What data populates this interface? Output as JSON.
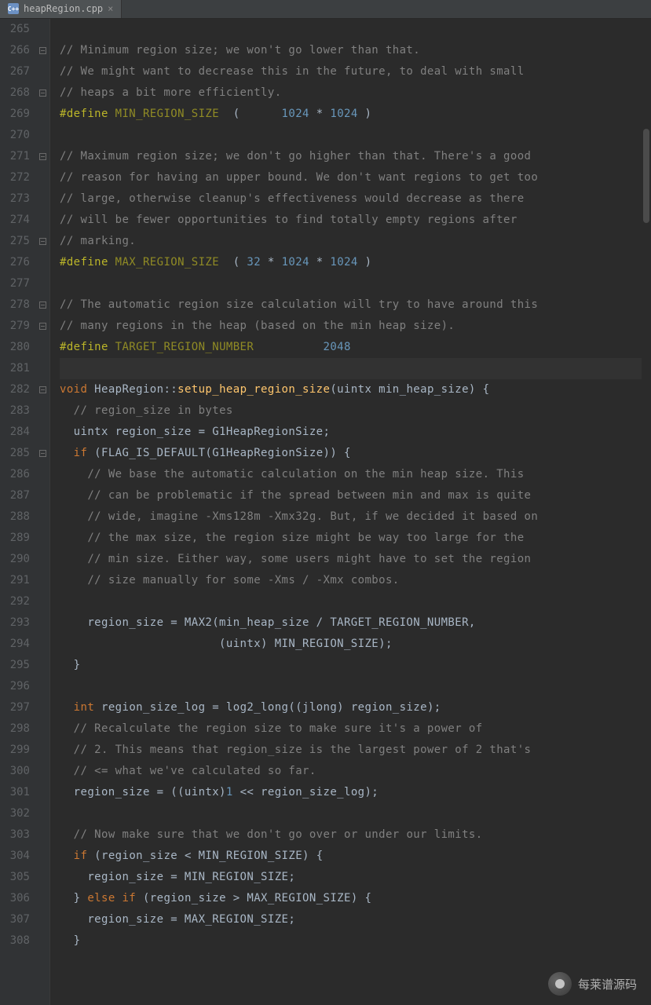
{
  "tab": {
    "icon_label": "C++",
    "filename": "heapRegion.cpp",
    "close_glyph": "×"
  },
  "line_start": 265,
  "highlight_line": 281,
  "fold_lines": [
    266,
    268,
    271,
    275,
    278,
    279,
    282,
    285
  ],
  "lines": [
    {
      "n": 265,
      "seg": [
        {
          "t": "",
          "cls": ""
        }
      ]
    },
    {
      "n": 266,
      "seg": [
        {
          "t": "// Minimum region size; we won't go lower than that.",
          "cls": "c-comment"
        }
      ]
    },
    {
      "n": 267,
      "seg": [
        {
          "t": "// We might want to decrease this in the future, to deal with small",
          "cls": "c-comment"
        }
      ]
    },
    {
      "n": 268,
      "seg": [
        {
          "t": "// heaps a bit more efficiently.",
          "cls": "c-comment"
        }
      ]
    },
    {
      "n": 269,
      "seg": [
        {
          "t": "#define ",
          "cls": "c-define"
        },
        {
          "t": "MIN_REGION_SIZE",
          "cls": "c-macro"
        },
        {
          "t": "  (      ",
          "cls": ""
        },
        {
          "t": "1024",
          "cls": "c-number"
        },
        {
          "t": " * ",
          "cls": ""
        },
        {
          "t": "1024",
          "cls": "c-number"
        },
        {
          "t": " )",
          "cls": ""
        }
      ]
    },
    {
      "n": 270,
      "seg": [
        {
          "t": "",
          "cls": ""
        }
      ]
    },
    {
      "n": 271,
      "seg": [
        {
          "t": "// Maximum region size; we don't go higher than that. There's a good",
          "cls": "c-comment"
        }
      ]
    },
    {
      "n": 272,
      "seg": [
        {
          "t": "// reason for having an upper bound. We don't want regions to get too",
          "cls": "c-comment"
        }
      ]
    },
    {
      "n": 273,
      "seg": [
        {
          "t": "// large, otherwise cleanup's effectiveness would decrease as there",
          "cls": "c-comment"
        }
      ]
    },
    {
      "n": 274,
      "seg": [
        {
          "t": "// will be fewer opportunities to find totally empty regions after",
          "cls": "c-comment"
        }
      ]
    },
    {
      "n": 275,
      "seg": [
        {
          "t": "// marking.",
          "cls": "c-comment"
        }
      ]
    },
    {
      "n": 276,
      "seg": [
        {
          "t": "#define ",
          "cls": "c-define"
        },
        {
          "t": "MAX_REGION_SIZE",
          "cls": "c-macro"
        },
        {
          "t": "  ( ",
          "cls": ""
        },
        {
          "t": "32",
          "cls": "c-number"
        },
        {
          "t": " * ",
          "cls": ""
        },
        {
          "t": "1024",
          "cls": "c-number"
        },
        {
          "t": " * ",
          "cls": ""
        },
        {
          "t": "1024",
          "cls": "c-number"
        },
        {
          "t": " )",
          "cls": ""
        }
      ]
    },
    {
      "n": 277,
      "seg": [
        {
          "t": "",
          "cls": ""
        }
      ]
    },
    {
      "n": 278,
      "seg": [
        {
          "t": "// The automatic region size calculation will try to have around this",
          "cls": "c-comment"
        }
      ]
    },
    {
      "n": 279,
      "seg": [
        {
          "t": "// many regions in the heap (based on the min heap size).",
          "cls": "c-comment"
        }
      ]
    },
    {
      "n": 280,
      "seg": [
        {
          "t": "#define ",
          "cls": "c-define"
        },
        {
          "t": "TARGET_REGION_NUMBER",
          "cls": "c-macro"
        },
        {
          "t": "          ",
          "cls": ""
        },
        {
          "t": "2048",
          "cls": "c-number"
        }
      ]
    },
    {
      "n": 281,
      "seg": [
        {
          "t": "",
          "cls": ""
        }
      ]
    },
    {
      "n": 282,
      "seg": [
        {
          "t": "void ",
          "cls": "c-type"
        },
        {
          "t": "HeapRegion::",
          "cls": "c-ident"
        },
        {
          "t": "setup_heap_region_size",
          "cls": "c-func"
        },
        {
          "t": "(uintx min_heap_size) {",
          "cls": "c-ident"
        }
      ]
    },
    {
      "n": 283,
      "seg": [
        {
          "t": "  ",
          "cls": ""
        },
        {
          "t": "// region_size in bytes",
          "cls": "c-comment"
        }
      ]
    },
    {
      "n": 284,
      "seg": [
        {
          "t": "  uintx region_size = G1HeapRegionSize;",
          "cls": "c-ident"
        }
      ]
    },
    {
      "n": 285,
      "seg": [
        {
          "t": "  ",
          "cls": ""
        },
        {
          "t": "if ",
          "cls": "c-keyword"
        },
        {
          "t": "(FLAG_IS_DEFAULT(G1HeapRegionSize)) {",
          "cls": "c-ident"
        }
      ]
    },
    {
      "n": 286,
      "seg": [
        {
          "t": "    ",
          "cls": ""
        },
        {
          "t": "// We base the automatic calculation on the min heap size. This",
          "cls": "c-comment"
        }
      ]
    },
    {
      "n": 287,
      "seg": [
        {
          "t": "    ",
          "cls": ""
        },
        {
          "t": "// can be problematic if the spread between min and max is quite",
          "cls": "c-comment"
        }
      ]
    },
    {
      "n": 288,
      "seg": [
        {
          "t": "    ",
          "cls": ""
        },
        {
          "t": "// wide, imagine -Xms128m -Xmx32g. But, if we decided it based on",
          "cls": "c-comment"
        }
      ]
    },
    {
      "n": 289,
      "seg": [
        {
          "t": "    ",
          "cls": ""
        },
        {
          "t": "// the max size, the region size might be way too large for the",
          "cls": "c-comment"
        }
      ]
    },
    {
      "n": 290,
      "seg": [
        {
          "t": "    ",
          "cls": ""
        },
        {
          "t": "// min size. Either way, some users might have to set the region",
          "cls": "c-comment"
        }
      ]
    },
    {
      "n": 291,
      "seg": [
        {
          "t": "    ",
          "cls": ""
        },
        {
          "t": "// size manually for some -Xms / -Xmx combos.",
          "cls": "c-comment"
        }
      ]
    },
    {
      "n": 292,
      "seg": [
        {
          "t": "",
          "cls": ""
        }
      ]
    },
    {
      "n": 293,
      "seg": [
        {
          "t": "    region_size = MAX2(min_heap_size / TARGET_REGION_NUMBER,",
          "cls": "c-ident"
        }
      ]
    },
    {
      "n": 294,
      "seg": [
        {
          "t": "                       (uintx) MIN_REGION_SIZE);",
          "cls": "c-ident"
        }
      ]
    },
    {
      "n": 295,
      "seg": [
        {
          "t": "  }",
          "cls": "c-ident"
        }
      ]
    },
    {
      "n": 296,
      "seg": [
        {
          "t": "",
          "cls": ""
        }
      ]
    },
    {
      "n": 297,
      "seg": [
        {
          "t": "  ",
          "cls": ""
        },
        {
          "t": "int ",
          "cls": "c-type"
        },
        {
          "t": "region_size_log = log2_long((jlong) region_size);",
          "cls": "c-ident"
        }
      ]
    },
    {
      "n": 298,
      "seg": [
        {
          "t": "  ",
          "cls": ""
        },
        {
          "t": "// Recalculate the region size to make sure it's a power of",
          "cls": "c-comment"
        }
      ]
    },
    {
      "n": 299,
      "seg": [
        {
          "t": "  ",
          "cls": ""
        },
        {
          "t": "// 2. This means that region_size is the largest power of 2 that's",
          "cls": "c-comment"
        }
      ]
    },
    {
      "n": 300,
      "seg": [
        {
          "t": "  ",
          "cls": ""
        },
        {
          "t": "// <= what we've calculated so far.",
          "cls": "c-comment"
        }
      ]
    },
    {
      "n": 301,
      "seg": [
        {
          "t": "  region_size = ((uintx)",
          "cls": "c-ident"
        },
        {
          "t": "1",
          "cls": "c-number"
        },
        {
          "t": " << region_size_log);",
          "cls": "c-ident"
        }
      ]
    },
    {
      "n": 302,
      "seg": [
        {
          "t": "",
          "cls": ""
        }
      ]
    },
    {
      "n": 303,
      "seg": [
        {
          "t": "  ",
          "cls": ""
        },
        {
          "t": "// Now make sure that we don't go over or under our limits.",
          "cls": "c-comment"
        }
      ]
    },
    {
      "n": 304,
      "seg": [
        {
          "t": "  ",
          "cls": ""
        },
        {
          "t": "if ",
          "cls": "c-keyword"
        },
        {
          "t": "(region_size < MIN_REGION_SIZE) {",
          "cls": "c-ident"
        }
      ]
    },
    {
      "n": 305,
      "seg": [
        {
          "t": "    region_size = MIN_REGION_SIZE;",
          "cls": "c-ident"
        }
      ]
    },
    {
      "n": 306,
      "seg": [
        {
          "t": "  } ",
          "cls": "c-ident"
        },
        {
          "t": "else if ",
          "cls": "c-keyword"
        },
        {
          "t": "(region_size > MAX_REGION_SIZE) {",
          "cls": "c-ident"
        }
      ]
    },
    {
      "n": 307,
      "seg": [
        {
          "t": "    region_size = MAX_REGION_SIZE;",
          "cls": "c-ident"
        }
      ]
    },
    {
      "n": 308,
      "seg": [
        {
          "t": "  }",
          "cls": "c-ident"
        }
      ]
    }
  ],
  "watermark": {
    "text": "每莱谱源码"
  }
}
